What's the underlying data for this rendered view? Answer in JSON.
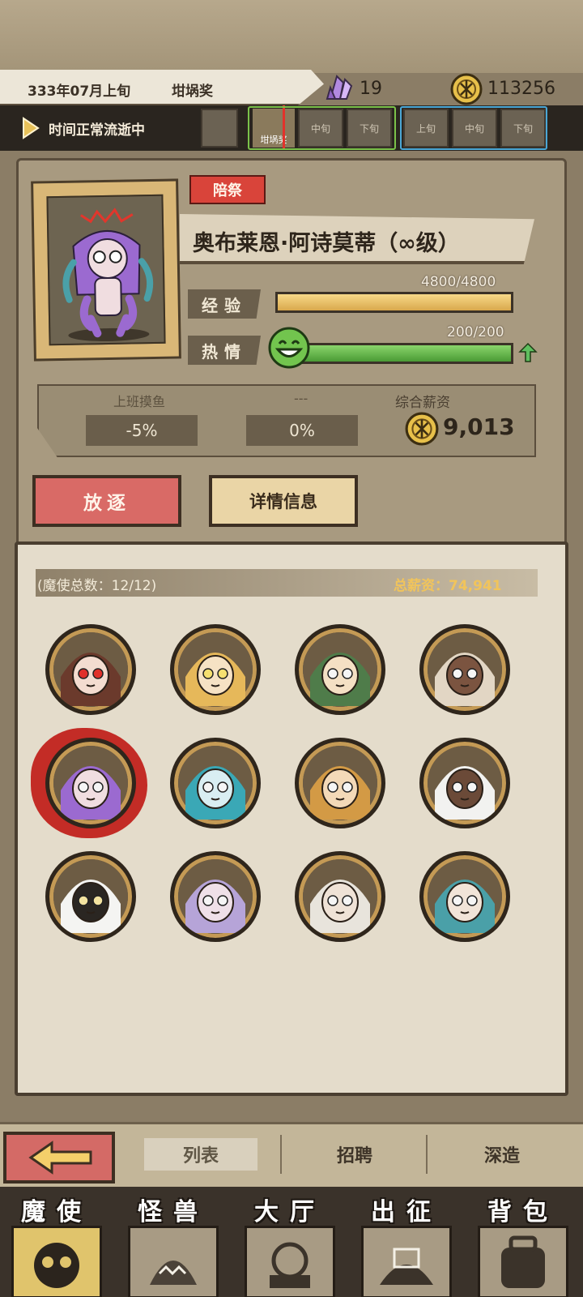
{
  "header": {
    "date": "333年07月上旬",
    "award": "坩埚奖",
    "crystal_count": "19",
    "coin_count": "113256"
  },
  "timeline": {
    "status": "时间正常流逝中",
    "periods": [
      {
        "label": "",
        "group": "prev"
      },
      {
        "label": "坩埚奖",
        "group": "current"
      },
      {
        "label": "中旬",
        "group": "current"
      },
      {
        "label": "下旬",
        "group": "current"
      },
      {
        "label": "上旬",
        "group": "next"
      },
      {
        "label": "中旬",
        "group": "next"
      },
      {
        "label": "下旬",
        "group": "next"
      }
    ]
  },
  "character": {
    "rank_badge": "陪祭",
    "name": "奥布莱恩·阿诗莫蒂（∞级）",
    "exp_label": "经验",
    "exp_value": "4800/4800",
    "exp_fraction": 1.0,
    "passion_label": "热情",
    "passion_value": "200/200",
    "passion_fraction": 1.0
  },
  "work_stats": {
    "col1_title": "上班摸鱼",
    "col1_value": "-5%",
    "col2_title": "---",
    "col2_value": "0%",
    "salary_title": "综合薪资",
    "salary_value": "9,013"
  },
  "actions": {
    "exile": "放逐",
    "details": "详情信息"
  },
  "roster": {
    "count_text": "(魔使总数：12/12)",
    "total_salary": "总薪资：74,941",
    "avatars": [
      {
        "name": "avatar-1",
        "skin": "#f3dcd0",
        "hair": "#6b3a2c",
        "eyes": "#e0302a"
      },
      {
        "name": "avatar-2",
        "skin": "#f6e2c4",
        "hair": "#e6b85a",
        "eyes": "#f6e070"
      },
      {
        "name": "avatar-3",
        "skin": "#f4e0c4",
        "hair": "#4f7c4a",
        "eyes": "#f5f5f5"
      },
      {
        "name": "avatar-4",
        "skin": "#7b5440",
        "hair": "#e2d6c4",
        "eyes": "#f5f5f5"
      },
      {
        "name": "avatar-5",
        "skin": "#f0dde0",
        "hair": "#9b6ad0",
        "eyes": "#f5f5f5"
      },
      {
        "name": "avatar-6",
        "skin": "#d9eef2",
        "hair": "#3aa8b6",
        "eyes": "#f5f5f5"
      },
      {
        "name": "avatar-7",
        "skin": "#f3d9b8",
        "hair": "#d39a45",
        "eyes": "#f5f5f5"
      },
      {
        "name": "avatar-8",
        "skin": "#6b4a38",
        "hair": "#f2f2f0",
        "eyes": "#f5f5f5"
      },
      {
        "name": "avatar-9",
        "skin": "#2a2622",
        "hair": "#f4f4f2",
        "eyes": "#f3e3a0"
      },
      {
        "name": "avatar-10",
        "skin": "#efe0e8",
        "hair": "#b6a4d8",
        "eyes": "#f5f5f5"
      },
      {
        "name": "avatar-11",
        "skin": "#efe2d6",
        "hair": "#e8e4dc",
        "eyes": "#f5f5f5"
      },
      {
        "name": "avatar-12",
        "skin": "#f1e4d8",
        "hair": "#4aa0a8",
        "eyes": "#f5f5f5"
      }
    ]
  },
  "subnav": {
    "tab_list": "列表",
    "tab_recruit": "招聘",
    "tab_train": "深造"
  },
  "mainnav": [
    {
      "label": "魔使",
      "icon": "skull-icon"
    },
    {
      "label": "怪兽",
      "icon": "monster-icon"
    },
    {
      "label": "大厅",
      "icon": "hall-icon"
    },
    {
      "label": "出征",
      "icon": "battle-icon"
    },
    {
      "label": "背包",
      "icon": "bag-icon"
    }
  ],
  "colors": {
    "accent_red": "#d9443a",
    "exp_bar": "#e9be68",
    "passion_bar": "#6cbf4f",
    "salary_gold": "#f1c45b"
  }
}
